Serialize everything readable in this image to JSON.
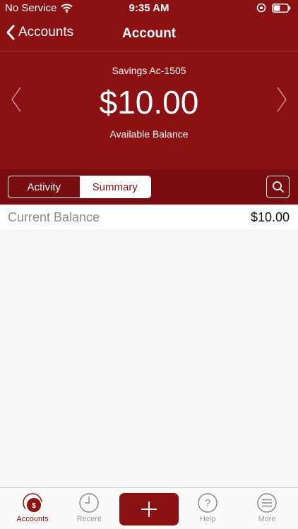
{
  "status_bar": {
    "carrier": "No Service",
    "time": "9:35 AM"
  },
  "nav": {
    "back_label": "Accounts",
    "title": "Account"
  },
  "account": {
    "name": "Savings Ac-1505",
    "balance": "$10.00",
    "balance_label": "Available Balance"
  },
  "segments": {
    "activity": "Activity",
    "summary": "Summary",
    "selected": "Summary"
  },
  "summary_rows": [
    {
      "label": "Current Balance",
      "value": "$10.00"
    }
  ],
  "tab_bar": {
    "tabs": [
      {
        "label": "Accounts",
        "icon": "accounts-dollar-icon",
        "active": true
      },
      {
        "label": "Recent",
        "icon": "clock-icon",
        "active": false
      },
      {
        "label": "",
        "icon": "plus-icon",
        "active": false
      },
      {
        "label": "Help",
        "icon": "help-icon",
        "active": false
      },
      {
        "label": "More",
        "icon": "menu-icon",
        "active": false
      }
    ]
  },
  "colors": {
    "brand": "#8b1113",
    "brand_dark": "#7a0d0f",
    "background": "#f7f7f7",
    "inactive_tab": "#9a9a9a"
  }
}
